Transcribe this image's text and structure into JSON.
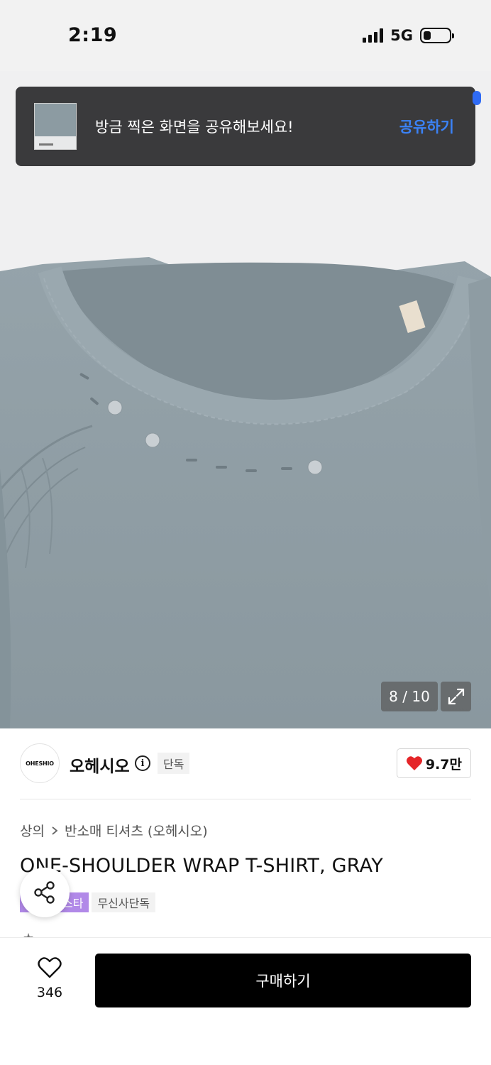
{
  "status_bar": {
    "time": "2:19",
    "network": "5G",
    "signal_bars": 4,
    "battery_level": 0.3
  },
  "toast": {
    "message": "방금 찍은 화면을 공유해보세요!",
    "action_label": "공유하기",
    "action_color": "#3b82f6"
  },
  "gallery": {
    "counter": "8 / 10",
    "current": 8,
    "total": 10,
    "expand_icon": "expand-icon",
    "shirt_color": "#8c9ba2"
  },
  "brand": {
    "logo_text": "OHESHIO",
    "name": "오헤시오",
    "tag": "단독",
    "likes": "9.7만",
    "heart_color": "#e52528"
  },
  "product": {
    "breadcrumb": [
      "상의",
      "반소매 티셔츠 (오헤시오)"
    ],
    "title": "ONE-SHOULDER WRAP T-SHIRT, GRAY",
    "badges": [
      {
        "label": "스타",
        "color": "#b189e8"
      },
      {
        "label": "무신사단독",
        "color": "#f2f2f2"
      }
    ]
  },
  "bottom_bar": {
    "wish_count": "346",
    "buy_label": "구매하기"
  }
}
